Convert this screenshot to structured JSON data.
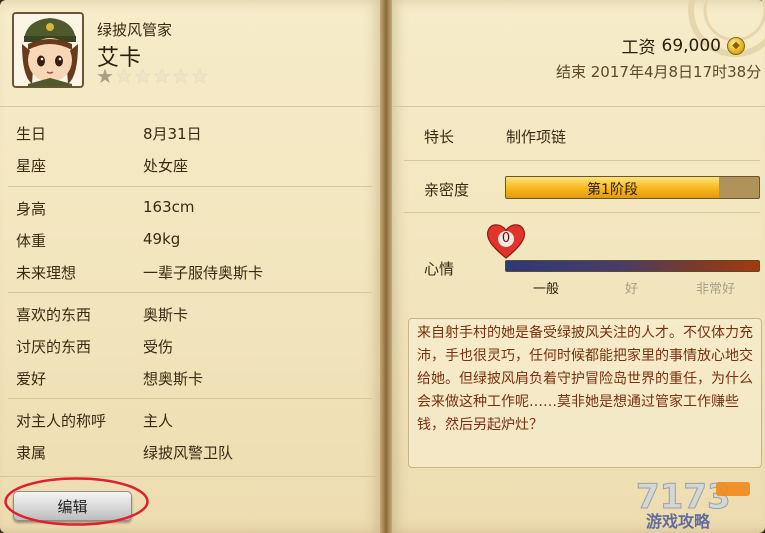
{
  "character": {
    "role": "绿披风管家",
    "name": "艾卡",
    "rating": 1,
    "max_rating": 6
  },
  "info": [
    {
      "label": "生日",
      "value": "8月31日"
    },
    {
      "label": "星座",
      "value": "处女座"
    },
    {
      "label": "身高",
      "value": "163cm"
    },
    {
      "label": "体重",
      "value": "49kg"
    },
    {
      "label": "未来理想",
      "value": "一辈子服侍奥斯卡"
    },
    {
      "label": "喜欢的东西",
      "value": "奥斯卡"
    },
    {
      "label": "讨厌的东西",
      "value": "受伤"
    },
    {
      "label": "爱好",
      "value": "想奥斯卡"
    },
    {
      "label": "对主人的称呼",
      "value": "主人"
    },
    {
      "label": "隶属",
      "value": "绿披风警卫队"
    }
  ],
  "edit_button": {
    "label": "编辑"
  },
  "wage": {
    "label": "工资",
    "amount": "69,000"
  },
  "end_time": "结束 2017年4月8日17时38分",
  "specialty": {
    "label": "特长",
    "value": "制作项链"
  },
  "intimacy": {
    "label": "亲密度",
    "stage": "第1阶段",
    "level": 0.84
  },
  "mood": {
    "label": "心情",
    "value": "0",
    "ticks": [
      {
        "label": "一般",
        "color": "#2a1d0c"
      },
      {
        "label": "好",
        "color": "#a8a088"
      },
      {
        "label": "非常好",
        "color": "#a8a088"
      }
    ]
  },
  "description": "来自射手村的她是备受绿披风关注的人才。不仅体力充沛，手也很灵巧，任何时候都能把家里的事情放心地交给她。但绿披风肩负着守护冒险岛世界的重任，为什么会来做这种工作呢……莫非她是想通过管家工作赚些钱，然后另起炉灶？",
  "watermark": {
    "text": "游戏攻略"
  },
  "colors": {
    "annotation_circle": "#e0202a",
    "accent_gold": "#f6b71e"
  }
}
